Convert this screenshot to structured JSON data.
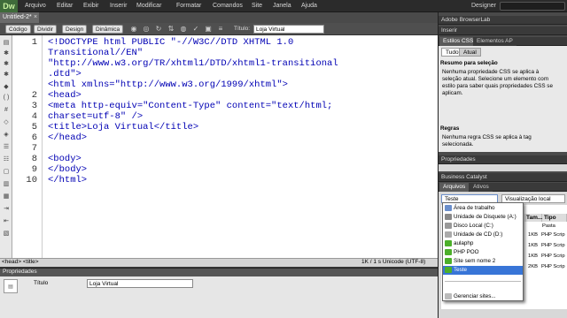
{
  "app": {
    "logo": "Dw"
  },
  "menu": [
    "Arquivo",
    "Editar",
    "Exibir",
    "Inserir",
    "Modificar",
    "Formatar",
    "Comandos",
    "Site",
    "Janela",
    "Ajuda"
  ],
  "workspace": "Designer",
  "document_tab": {
    "name": "Untitled-2*",
    "close": "×"
  },
  "view_buttons": [
    "Código",
    "Dividir",
    "Design",
    "Dinâmica"
  ],
  "title_label": "Título:",
  "title_value": "Loja Virtual",
  "line_numbers": [
    "1",
    "2",
    "3",
    "4",
    "5",
    "6",
    "7",
    "8",
    "9",
    "10"
  ],
  "code_lines": [
    "<!DOCTYPE html PUBLIC \"-//W3C//DTD XHTML 1.0",
    "Transitional//EN\"",
    "\"http://www.w3.org/TR/xhtml1/DTD/xhtml1-transitional",
    ".dtd\">",
    "<html xmlns=\"http://www.w3.org/1999/xhtml\">",
    "<head>",
    "<meta http-equiv=\"Content-Type\" content=\"text/html;",
    "charset=utf-8\" />",
    "<title>Loja Virtual</title>",
    "</head>",
    "",
    "<body>",
    "</body>",
    "</html>"
  ],
  "status": {
    "tag_path": "<head> <title>",
    "right": "1K / 1 s  Unicode (UTF-8)"
  },
  "properties": {
    "header": "Propriedades",
    "label": "Título",
    "value": "Loja Virtual"
  },
  "panel": {
    "browserlab": "Adobe BrowserLab",
    "inserir": "Inserir",
    "css_tabs": [
      "Estilos CSS",
      "Elementos AP"
    ],
    "css_mode_tabs": [
      "Tudo",
      "Atual"
    ],
    "summary_title": "Resumo para seleção",
    "summary_text": [
      "Nenhuma propriedade CSS se aplica à",
      "seleção atual. Selecione um elemento com",
      "estilo para saber quais propriedades CSS se",
      "aplicam."
    ],
    "rules_title": "Regras",
    "rules_text": [
      "Nenhuma regra CSS se aplica à tag",
      "selecionada."
    ],
    "propriedades": "Propriedades",
    "business": "Business Catalyst",
    "file_tabs": [
      "Arquivos",
      "Ativos"
    ],
    "site_select": "Teste",
    "view_select": "Visualização local",
    "file_headers": [
      "Tam...",
      "Tipo"
    ],
    "file_sub": "Pasta",
    "file_rows": [
      [
        "1KB",
        "PHP Scrip"
      ],
      [
        "1KB",
        "PHP Scrip"
      ],
      [
        "1KB",
        "PHP Scrip"
      ],
      [
        "2KB",
        "PHP Scrip"
      ]
    ]
  },
  "site_dropdown": [
    "Área de trabalho",
    "Unidade de Disquete (A:)",
    "Disco Local (C:)",
    "Unidade de CD (D:)",
    "aulaphp",
    "PHP POO",
    "Site sem nome 2",
    "Teste",
    "",
    "Gerenciar sites..."
  ],
  "colors": {
    "accent": "#3875d7",
    "folder": "#4caf2a",
    "drive": "#6a8ecb"
  }
}
